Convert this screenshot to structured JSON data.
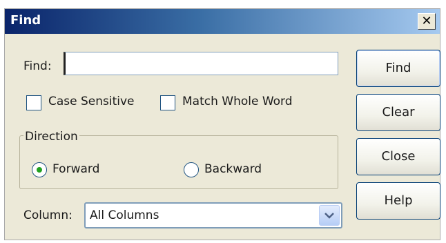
{
  "window": {
    "title": "Find",
    "close_glyph": "✕"
  },
  "find": {
    "label": "Find:",
    "value": ""
  },
  "options": {
    "case_sensitive": {
      "label": "Case Sensitive",
      "checked": false
    },
    "match_whole_word": {
      "label": "Match Whole Word",
      "checked": false
    }
  },
  "direction": {
    "legend": "Direction",
    "forward": {
      "label": "Forward",
      "selected": true
    },
    "backward": {
      "label": "Backward",
      "selected": false
    }
  },
  "column": {
    "label": "Column:",
    "value": "All Columns"
  },
  "buttons": {
    "find": "Find",
    "clear": "Clear",
    "close": "Close",
    "help": "Help"
  },
  "colors": {
    "title_start": "#0a246a",
    "title_end": "#a6caf0",
    "dialog_bg": "#ece9d8",
    "radio_dot": "#21a121"
  }
}
